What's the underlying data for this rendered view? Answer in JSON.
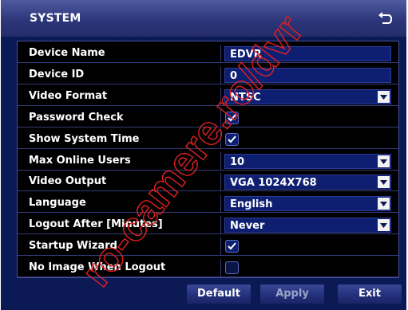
{
  "window": {
    "title": "SYSTEM"
  },
  "settings": [
    {
      "label": "Device Name",
      "kind": "text",
      "value": "EDVR"
    },
    {
      "label": "Device ID",
      "kind": "text",
      "value": "0"
    },
    {
      "label": "Video Format",
      "kind": "select",
      "value": "NTSC"
    },
    {
      "label": "Password Check",
      "kind": "checkbox",
      "checked": true
    },
    {
      "label": "Show System Time",
      "kind": "checkbox",
      "checked": true
    },
    {
      "label": "Max Online Users",
      "kind": "select",
      "value": "10"
    },
    {
      "label": "Video Output",
      "kind": "select",
      "value": "VGA 1024X768"
    },
    {
      "label": "Language",
      "kind": "select",
      "value": "English"
    },
    {
      "label": "Logout After [Minutes]",
      "kind": "select",
      "value": "Never"
    },
    {
      "label": "Startup Wizard",
      "kind": "checkbox",
      "checked": true
    },
    {
      "label": "No Image When Logout",
      "kind": "checkbox",
      "checked": false
    }
  ],
  "buttons": {
    "default": "Default",
    "apply": "Apply",
    "exit": "Exit"
  },
  "watermark": {
    "text": "ro-camere.ro/dvr"
  },
  "icons": {
    "back": "back-arrow-icon",
    "dropdown": "dropdown-arrow-icon",
    "check": "check-icon"
  },
  "colors": {
    "titlebar": "#2d3679",
    "background": "#0b1a55",
    "field": "#0e1f72",
    "watermark": "#e02020"
  }
}
